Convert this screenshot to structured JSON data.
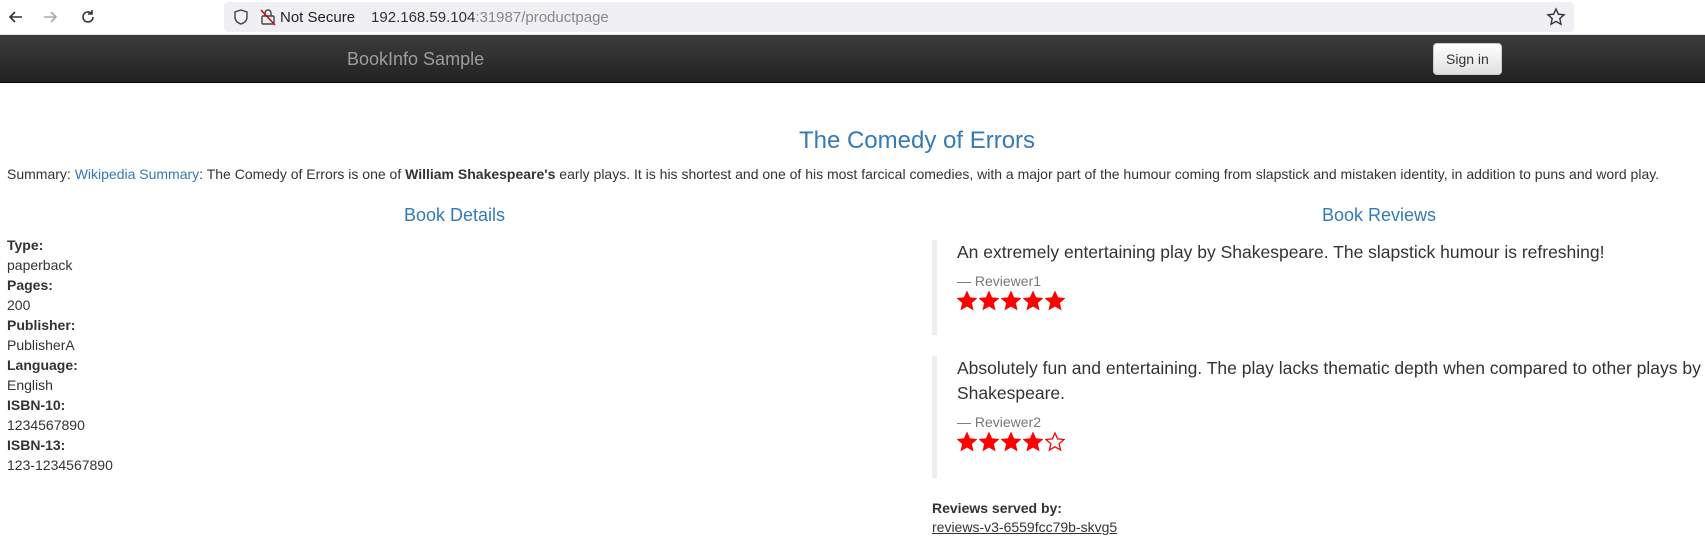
{
  "browser": {
    "security_label": "Not Secure",
    "url_host": "192.168.59.104",
    "url_rest": ":31987/productpage"
  },
  "navbar": {
    "brand": "BookInfo Sample",
    "signin_label": "Sign in"
  },
  "product": {
    "title": "The Comedy of Errors",
    "summary_prefix": "Summary: ",
    "summary_link": "Wikipedia Summary",
    "summary_mid": ": The Comedy of Errors is one of ",
    "summary_bold": "William Shakespeare's",
    "summary_end": " early plays. It is his shortest and one of his most farcical comedies, with a major part of the humour coming from slapstick and mistaken identity, in addition to puns and word play."
  },
  "details": {
    "heading": "Book Details",
    "fields": [
      {
        "key": "Type:",
        "value": "paperback"
      },
      {
        "key": "Pages:",
        "value": "200"
      },
      {
        "key": "Publisher:",
        "value": "PublisherA"
      },
      {
        "key": "Language:",
        "value": "English"
      },
      {
        "key": "ISBN-10:",
        "value": "1234567890"
      },
      {
        "key": "ISBN-13:",
        "value": "123-1234567890"
      }
    ]
  },
  "reviews": {
    "heading": "Book Reviews",
    "star_color": "#ff0000",
    "items": [
      {
        "text": "An extremely entertaining play by Shakespeare. The slapstick humour is refreshing!",
        "reviewer": "— Reviewer1",
        "rating": 5
      },
      {
        "text": "Absolutely fun and entertaining. The play lacks thematic depth when compared to other plays by Shakespeare.",
        "reviewer": "— Reviewer2",
        "rating": 4
      }
    ],
    "served_label": "Reviews served by:",
    "served_pod": "reviews-v3-6559fcc79b-skvg5"
  }
}
